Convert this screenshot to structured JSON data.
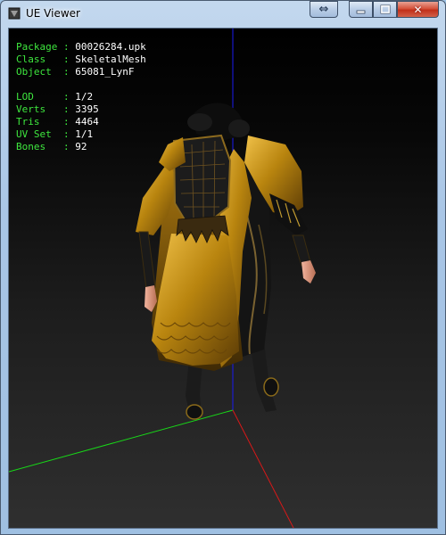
{
  "window": {
    "title": "UE Viewer"
  },
  "controls": {
    "swap_icon": "⇔",
    "close_icon": "✕"
  },
  "info": {
    "package_label": "Package :",
    "package_value": "00026284.upk",
    "class_label": "Class   :",
    "class_value": "SkeletalMesh",
    "object_label": "Object  :",
    "object_value": "65081_LynF",
    "lod_label": "LOD     :",
    "lod_value": "1/2",
    "verts_label": "Verts   :",
    "verts_value": "3395",
    "tris_label": "Tris    :",
    "tris_value": "4464",
    "uvset_label": "UV Set  :",
    "uvset_value": "1/1",
    "bones_label": "Bones   :",
    "bones_value": "92"
  },
  "colors": {
    "info_key": "#3ee73e",
    "info_value": "#ffffff",
    "axis_x": "#d81818",
    "axis_y": "#18d818",
    "axis_z": "#1a1af0",
    "mesh_gold": "#b98512",
    "mesh_dark": "#1a1a1a"
  }
}
